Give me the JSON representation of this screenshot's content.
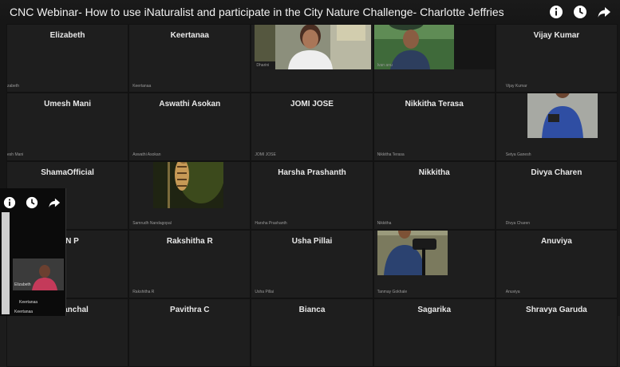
{
  "title": "CNC Webinar- How to use iNaturalist and participate in the City Nature Challenge- Charlotte Jeffries",
  "icons": [
    "info-icon",
    "clock-icon",
    "share-icon"
  ],
  "rows": [
    {
      "names": [
        "Elizabeth",
        "Keertanaa",
        "",
        "",
        "Vijay Kumar"
      ],
      "captions": [
        "zabeth",
        "Keertanaa",
        "Dharini",
        "Ivan anu",
        "Vijay Kumar"
      ]
    },
    {
      "names": [
        "Umesh Mani",
        "Aswathi Asokan",
        "JOMI JOSE",
        "Nikkitha Terasa",
        ""
      ],
      "captions": [
        "esh Mani",
        "Aswathi Asokan",
        "JOMI JOSE",
        "Nikkitha Terasa",
        "Setya Ganesh"
      ]
    },
    {
      "names": [
        "ShamaOfficial",
        "",
        "Harsha Prashanth",
        "Nikkitha",
        "Divya Charen"
      ],
      "captions": [
        "",
        "Samrudh Nandagopal",
        "Harsha Prashanth",
        "Nikkitha",
        "Divya Charen"
      ]
    },
    {
      "names": [
        "PAN P",
        "Rakshitha R",
        "Usha Pillai",
        "",
        "Anuviya"
      ],
      "captions": [
        "",
        "Rakshitha R",
        "Usha Pillai",
        "Tanmay Gokhale",
        "Anuviya"
      ]
    },
    {
      "names": [
        "panchal",
        "Pavithra C",
        "Bianca",
        "Sagarika",
        "Shravya Garuda"
      ],
      "captions": [
        "",
        "",
        "",
        "",
        ""
      ]
    }
  ],
  "overlay": {
    "video_label": "Elizabeth",
    "line1": "Keertanaa",
    "line2": "Keertanaa"
  }
}
